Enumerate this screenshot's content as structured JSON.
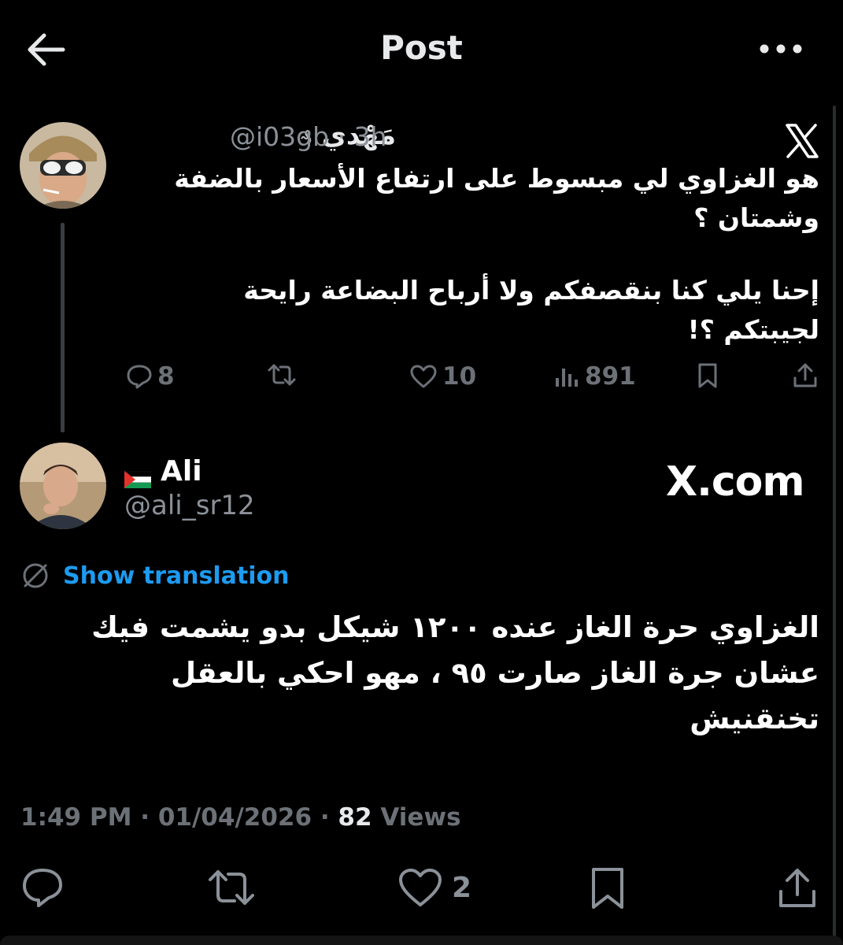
{
  "header": {
    "title": "Post"
  },
  "quoted_post": {
    "name": "مَهْدي",
    "name_suffix": "₰",
    "handle": "@i03gb",
    "separator": "·",
    "time": "3h",
    "text_lines": [
      "هو الغزاوي لي مبسوط على ارتفاع الأسعار بالضفة",
      "وشمتان ؟",
      "",
      "إحنا يلي كنا بنقصفكم ولا أرباح البضاعة رايحة",
      "لجيبتكم ؟!"
    ],
    "metrics": {
      "replies": "8",
      "likes": "10",
      "views": "891"
    }
  },
  "main_post": {
    "flag": "🇵🇸",
    "name": "Ali",
    "handle": "@ali_sr12",
    "watermark": "X.com",
    "translate_label": "Show translation",
    "text_lines": [
      "الغزاوي حرة الغاز عنده ١٢٠٠ شيكل بدو يشمت فيك",
      "عشان جرة الغاز صارت ٩٥ ، مهو احكي  بالعقل",
      "تخنقنيش"
    ],
    "time": "1:49 PM",
    "sep1": "·",
    "date": "01/04/2026",
    "sep2": "·",
    "views_count": "82",
    "views_label": "Views",
    "likes": "2"
  }
}
